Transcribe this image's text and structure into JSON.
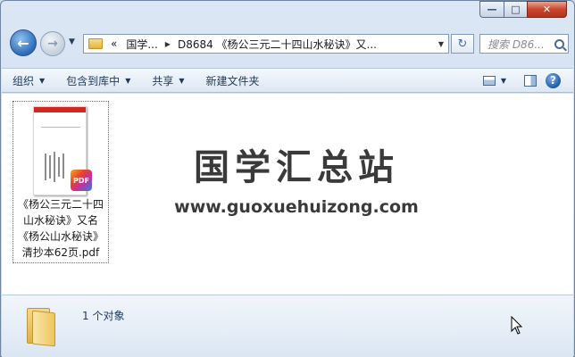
{
  "window": {
    "caption": {
      "minimize": "—",
      "maximize": "□",
      "close": "✕"
    }
  },
  "nav": {
    "back_icon": "back-arrow-icon",
    "forward_icon": "forward-arrow-icon",
    "breadcrumb": [
      "«",
      "国学...",
      "D8684 《杨公三元二十四山水秘诀》又..."
    ],
    "search_placeholder": "搜索 D86..."
  },
  "toolbar": {
    "organize": "组织",
    "include_library": "包含到库中",
    "share": "共享",
    "new_folder": "新建文件夹"
  },
  "content": {
    "file": {
      "name": "《杨公三元二十四山水秘诀》又名《杨公山水秘诀》清抄本62页.pdf",
      "badge": "PDF"
    },
    "watermark": {
      "title": "国学汇总站",
      "url": "www.guoxuehuizong.com"
    }
  },
  "details": {
    "count": "1 个对象"
  }
}
